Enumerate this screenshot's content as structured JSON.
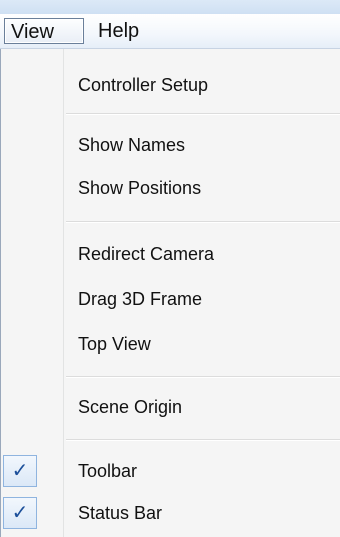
{
  "menubar": {
    "view_label": "View",
    "help_label": "Help"
  },
  "menu": {
    "controller_setup": "Controller Setup",
    "show_names": "Show Names",
    "show_positions": "Show Positions",
    "redirect_camera": "Redirect Camera",
    "drag_3d_frame": "Drag 3D Frame",
    "top_view": "Top View",
    "scene_origin": "Scene Origin",
    "toolbar": "Toolbar",
    "status_bar": "Status Bar"
  },
  "checks": {
    "glyph": "✓",
    "toolbar_checked": true,
    "status_bar_checked": true,
    "color": "#1c4f9a"
  },
  "icons": [
    "check-icon"
  ]
}
